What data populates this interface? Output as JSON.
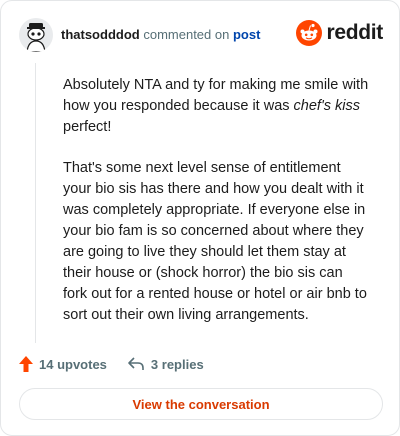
{
  "header": {
    "username": "thatsodddod",
    "action_text": "commented on",
    "post_link": "post",
    "brand": "reddit"
  },
  "comment": {
    "p1_before": "Absolutely NTA and ty for making me smile with how you responded because it was ",
    "p1_emphasis": "chef's kiss",
    "p1_after": " perfect!",
    "p2": "That's some next level sense of entitlement your bio sis has there and how you dealt with it was completely appropriate. If everyone else in your bio fam is so concerned about where they are going to live they should let them stay at their house or (shock horror) the bio sis can fork out for a rented house or hotel or air bnb to sort out their own living arrangements."
  },
  "actions": {
    "upvotes": "14 upvotes",
    "replies": "3 replies"
  },
  "cta": {
    "label": "View the conversation"
  },
  "colors": {
    "accent": "#d93a00",
    "upvote": "#ff4500",
    "link": "#0045ac",
    "muted": "#576f76"
  },
  "icons": {
    "avatar": "snoo-avatar-icon",
    "brand": "reddit-snoo-logo-icon",
    "upvote": "upvote-arrow-icon",
    "reply": "reply-arrow-icon"
  }
}
